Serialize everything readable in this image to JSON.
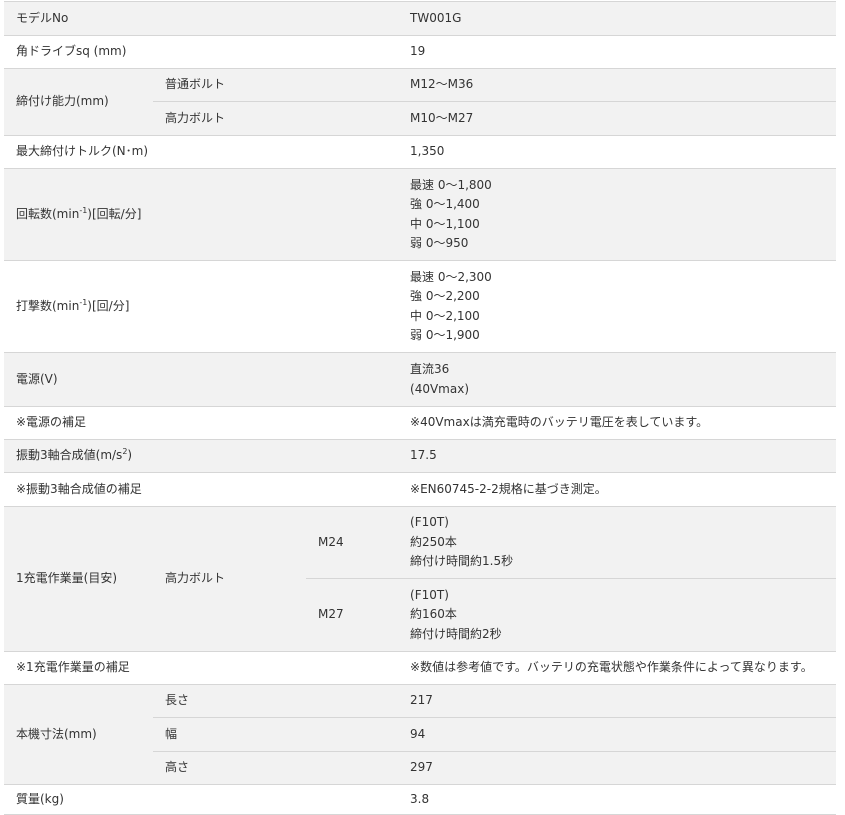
{
  "rows": {
    "model": {
      "label": "モデルNo",
      "value": "TW001G"
    },
    "drive": {
      "label": "角ドライブsq (mm)",
      "value": "19"
    },
    "capacity": {
      "label": "締付け能力(mm)",
      "normal_label": "普通ボルト",
      "normal_value": "M12〜M36",
      "high_label": "高力ボルト",
      "high_value": "M10〜M27"
    },
    "torque": {
      "label": "最大締付けトルク(N･m)",
      "value": "1,350"
    },
    "rpm": {
      "label_pre": "回転数(min",
      "label_sup": "-1",
      "label_post": ")[回転/分]",
      "lines": [
        "最速 0〜1,800",
        "強 0〜1,400",
        "中 0〜1,100",
        "弱 0〜950"
      ]
    },
    "ipm": {
      "label_pre": "打撃数(min",
      "label_sup": "-1",
      "label_post": ")[回/分]",
      "lines": [
        "最速 0〜2,300",
        "強 0〜2,200",
        "中 0〜2,100",
        "弱 0〜1,900"
      ]
    },
    "power": {
      "label": "電源(V)",
      "lines": [
        "直流36",
        "(40Vmax)"
      ]
    },
    "power_note": {
      "label": "※電源の補足",
      "value": "※40Vmaxは満充電時のバッテリ電圧を表しています。"
    },
    "vibration": {
      "label_pre": "振動3軸合成値(m/s",
      "label_sup": "2",
      "label_post": ")",
      "value": "17.5"
    },
    "vibration_note": {
      "label": "※振動3軸合成値の補足",
      "value": "※EN60745-2-2規格に基づき測定。"
    },
    "work": {
      "label": "1充電作業量(目安)",
      "sub_label": "高力ボルト",
      "m24_label": "M24",
      "m24_lines": [
        "(F10T)",
        "約250本",
        "締付け時間約1.5秒"
      ],
      "m27_label": "M27",
      "m27_lines": [
        "(F10T)",
        "約160本",
        "締付け時間約2秒"
      ]
    },
    "work_note": {
      "label": "※1充電作業量の補足",
      "value": "※数値は参考値です。バッテリの充電状態や作業条件によって異なります。"
    },
    "dimensions": {
      "label": "本機寸法(mm)",
      "length_label": "長さ",
      "length_value": "217",
      "width_label": "幅",
      "width_value": "94",
      "height_label": "高さ",
      "height_value": "297"
    },
    "weight": {
      "label": "質量(kg)",
      "value": "3.8"
    }
  }
}
